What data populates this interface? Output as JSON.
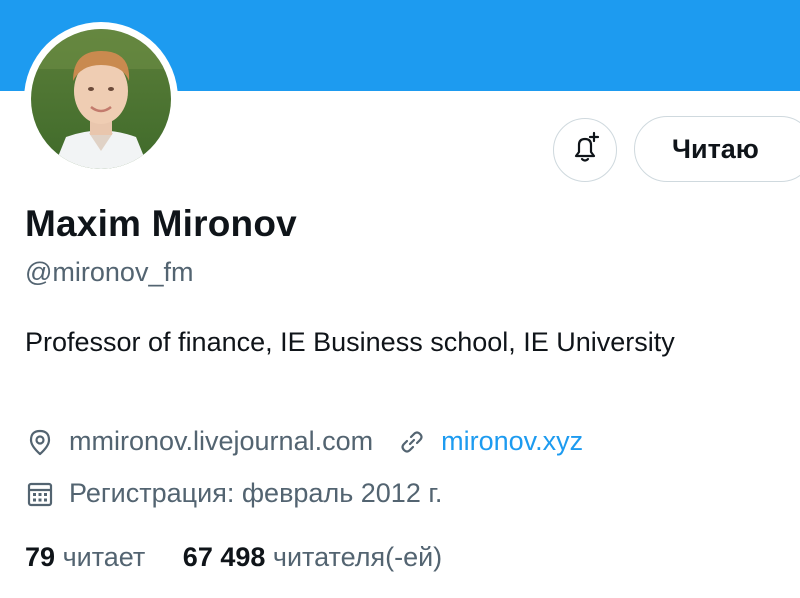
{
  "profile": {
    "name": "Maxim Mironov",
    "handle": "@mironov_fm",
    "bio": "Professor of finance, IE Business school, IE University",
    "location": "mmironov.livejournal.com",
    "website": "mironov.xyz",
    "joined": "Регистрация: февраль 2012 г."
  },
  "actions": {
    "follow_label": "Читаю"
  },
  "stats": {
    "following_count": "79",
    "following_label": "читает",
    "followers_count": "67 498",
    "followers_label": "читателя(-ей)"
  },
  "colors": {
    "banner": "#1d9bf0",
    "link": "#1d9bf0",
    "secondary_text": "#536471"
  },
  "icons": [
    "location-pin-icon",
    "link-icon",
    "calendar-icon",
    "bell-plus-icon"
  ]
}
